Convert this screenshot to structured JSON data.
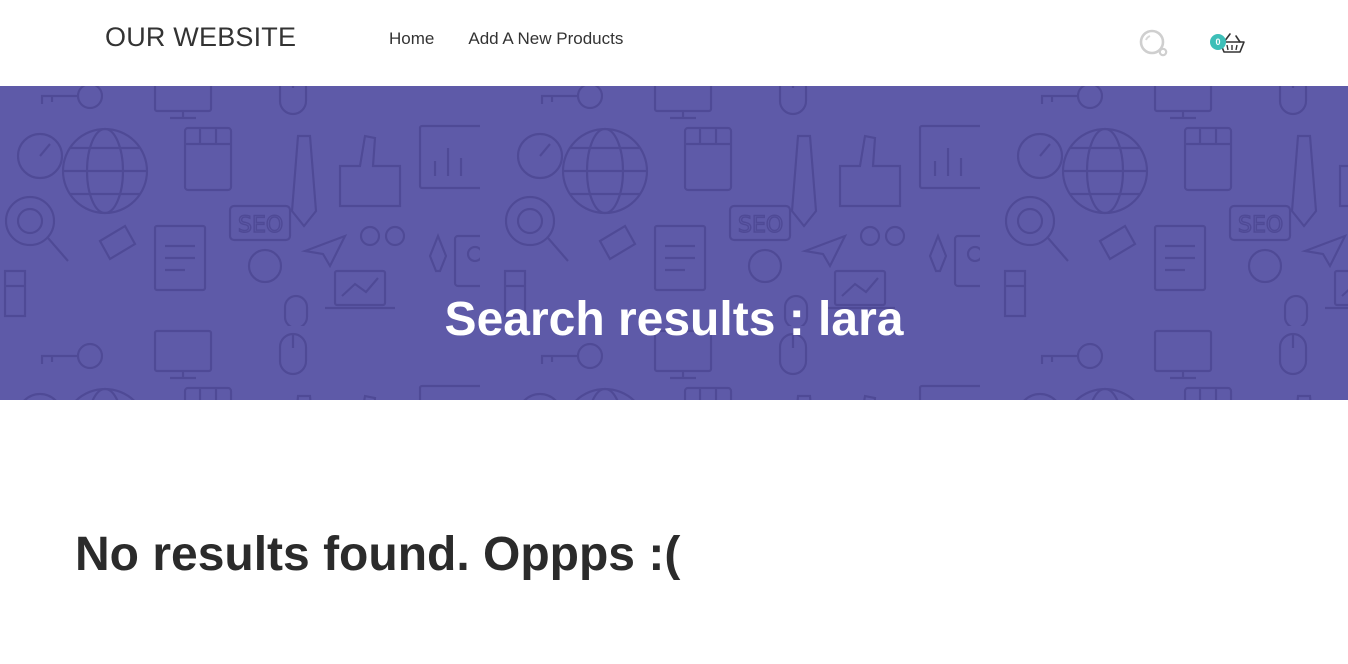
{
  "header": {
    "logo": "OUR WEBSITE",
    "nav": [
      {
        "label": "Home"
      },
      {
        "label": "Add A New Products"
      }
    ],
    "cart_count": "0"
  },
  "banner": {
    "title": "Search results : lara",
    "background_color": "#5e5aa8",
    "pattern_color": "#4f4a96"
  },
  "main": {
    "message": "No results found. Oppps :("
  },
  "colors": {
    "badge": "#3dbfb8",
    "icon_gray": "#cfcfcf"
  },
  "icons": [
    "search-icon",
    "cart-icon"
  ]
}
